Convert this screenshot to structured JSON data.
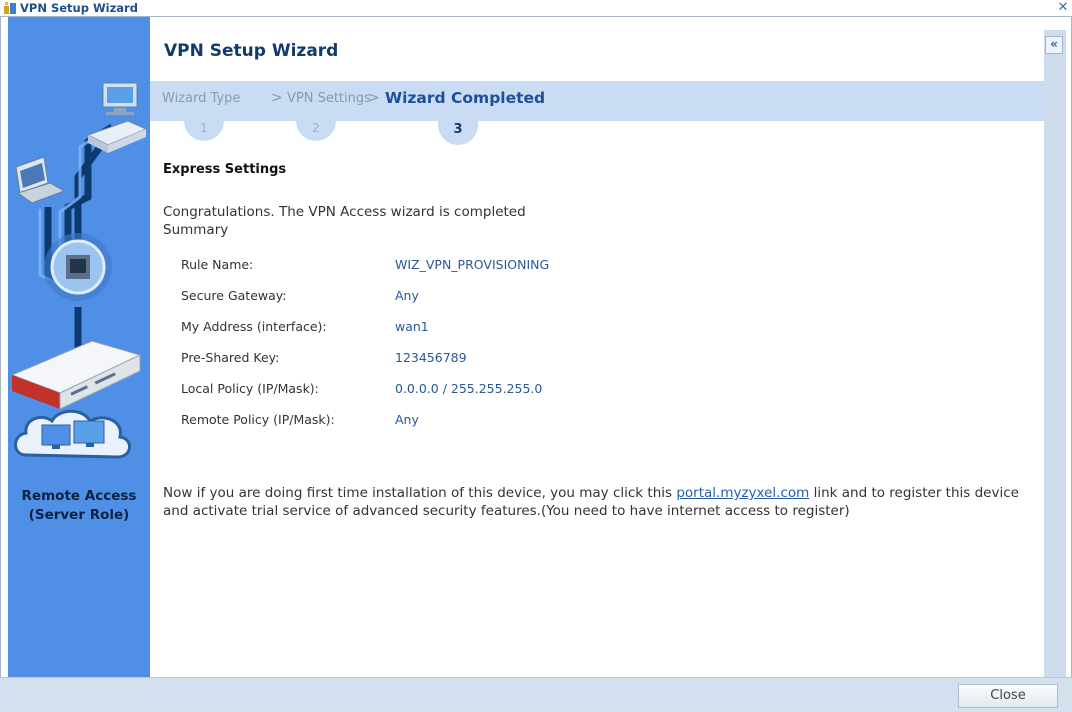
{
  "window": {
    "title": "VPN Setup Wizard",
    "close_glyph": "✕"
  },
  "sidebar": {
    "caption_line1": "Remote Access",
    "caption_line2": "(Server Role)",
    "collapse_glyph": "«"
  },
  "wizard": {
    "title": "VPN Setup Wizard",
    "steps": [
      {
        "label": "Wizard Type",
        "number": "1",
        "state": "done"
      },
      {
        "label": "VPN Settings",
        "number": "2",
        "state": "done"
      },
      {
        "label": "Wizard Completed",
        "number": "3",
        "state": "active"
      }
    ],
    "separator": ">"
  },
  "content": {
    "section_title": "Express Settings",
    "congrats": "Congratulations. The VPN Access wizard is completed",
    "summary_label": "Summary",
    "summary": [
      {
        "label": "Rule Name:",
        "value": "WIZ_VPN_PROVISIONING"
      },
      {
        "label": "Secure Gateway:",
        "value": "Any"
      },
      {
        "label": "My Address (interface):",
        "value": "wan1"
      },
      {
        "label": "Pre-Shared Key:",
        "value": "123456789"
      },
      {
        "label": "Local Policy (IP/Mask):",
        "value": "0.0.0.0 / 255.255.255.0"
      },
      {
        "label": "Remote Policy (IP/Mask):",
        "value": "Any"
      }
    ],
    "info_before": "Now if you are doing first time installation of this device, you may click this ",
    "info_link": "portal.myzyxel.com",
    "info_after": " link and to register this device and activate trial service of advanced security features.(You need to have internet access to register)"
  },
  "footer": {
    "close_label": "Close"
  },
  "colors": {
    "sidebar_bg": "#4f8fe6",
    "steps_bar": "#c9dcf3",
    "title_text": "#123b6c",
    "value_text": "#2b5797",
    "link": "#2b5db1"
  }
}
